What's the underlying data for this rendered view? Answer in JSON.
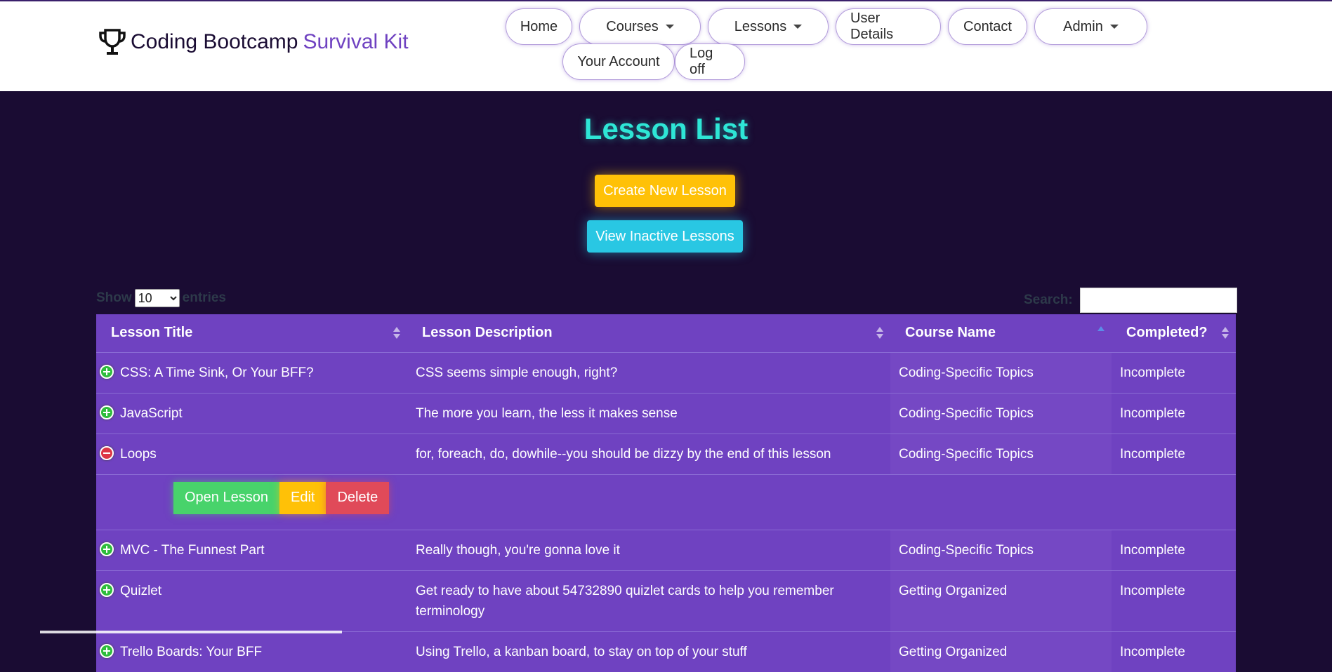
{
  "brand": {
    "name": "Coding Bootcamp",
    "accent": "Survival Kit",
    "icon": "trophy-icon"
  },
  "nav": {
    "home": "Home",
    "courses": "Courses",
    "lessons": "Lessons",
    "user_details": "User Details",
    "contact": "Contact",
    "admin": "Admin",
    "your_account": "Your Account",
    "log_off": "Log off"
  },
  "page": {
    "title": "Lesson List",
    "create_button": "Create New Lesson",
    "inactive_button": "View Inactive Lessons"
  },
  "table_controls": {
    "show_label": "Show",
    "entries_label": "entries",
    "page_size": "10",
    "search_label": "Search:",
    "search_value": ""
  },
  "table": {
    "columns": [
      "Lesson Title",
      "Lesson Description",
      "Course Name",
      "Completed?"
    ],
    "rows": [
      {
        "title": "CSS: A Time Sink, Or Your BFF?",
        "description": "CSS seems simple enough, right?",
        "course": "Coding-Specific Topics",
        "completed": "Incomplete"
      },
      {
        "title": "JavaScript",
        "description": "The more you learn, the less it makes sense",
        "course": "Coding-Specific Topics",
        "completed": "Incomplete"
      },
      {
        "title": "Loops",
        "description": "for, foreach, do, dowhile--you should be dizzy by the end of this lesson",
        "course": "Coding-Specific Topics",
        "completed": "Incomplete"
      },
      {
        "title": "MVC - The Funnest Part",
        "description": "Really though, you're gonna love it",
        "course": "Coding-Specific Topics",
        "completed": "Incomplete"
      },
      {
        "title": "Quizlet",
        "description": "Get ready to have about 54732890 quizlet cards to help you remember terminology",
        "course": "Getting Organized",
        "completed": "Incomplete"
      },
      {
        "title": "Trello Boards: Your BFF",
        "description": "Using Trello, a kanban board, to stay on top of your stuff",
        "course": "Getting Organized",
        "completed": "Incomplete"
      }
    ],
    "row_actions": {
      "open": "Open Lesson",
      "edit": "Edit",
      "delete": "Delete"
    }
  },
  "colors": {
    "background": "#1a0c33",
    "table": "#6f42c1",
    "title": "#2ee6d6",
    "warning": "#ffc107",
    "info": "#29c7e3",
    "success": "#48d36b",
    "danger": "#e04a59"
  }
}
